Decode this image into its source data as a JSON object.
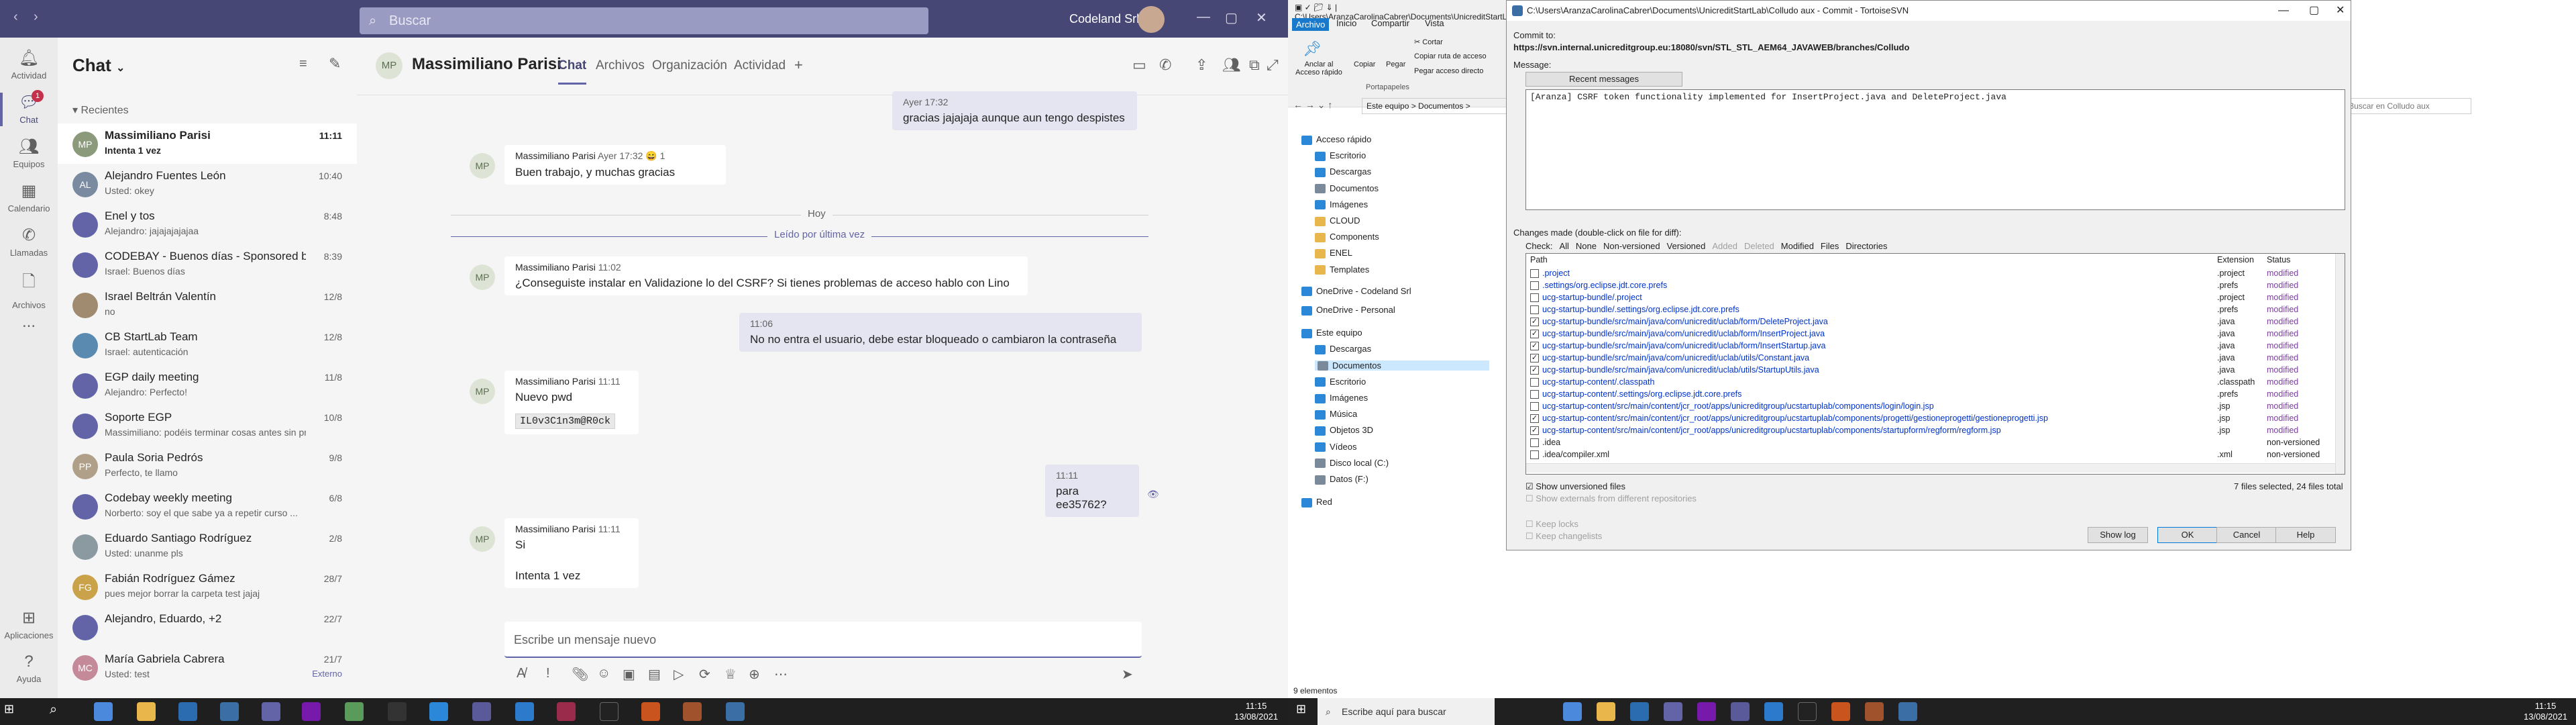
{
  "teams": {
    "search_placeholder": "Buscar",
    "org": "Codeland Srl",
    "rail": [
      {
        "label": "Actividad",
        "icon": "bell-icon"
      },
      {
        "label": "Chat",
        "icon": "chat-icon",
        "badge": "1"
      },
      {
        "label": "Equipos",
        "icon": "teams-icon"
      },
      {
        "label": "Calendario",
        "icon": "calendar-icon"
      },
      {
        "label": "Llamadas",
        "icon": "phone-icon"
      },
      {
        "label": "Archivos",
        "icon": "file-icon"
      },
      {
        "label": "...",
        "icon": "more-icon"
      },
      {
        "label": "Aplicaciones",
        "icon": "apps-icon"
      },
      {
        "label": "Ayuda",
        "icon": "help-icon"
      }
    ],
    "chatlist": {
      "title": "Chat",
      "section": "Recientes",
      "items": [
        {
          "initials": "MP",
          "name": "Massimiliano Parisi",
          "preview": "Intenta 1 vez",
          "time": "11:11",
          "color": "#8a9a7b"
        },
        {
          "initials": "AL",
          "name": "Alejandro Fuentes León",
          "preview": "Usted: okey",
          "time": "10:40",
          "color": "#7a8aa0"
        },
        {
          "initials": "",
          "name": "Enel y tos",
          "preview": "Alejandro: jajajajajajaa",
          "time": "8:48",
          "color": "#6264a7"
        },
        {
          "initials": "",
          "name": "CODEBAY - Buenos días - Sponsored by...",
          "preview": "Israel: Buenos días",
          "time": "8:39",
          "color": "#6264a7"
        },
        {
          "initials": "",
          "name": "Israel Beltrán Valentín",
          "preview": "no",
          "time": "12/8",
          "color": "#a08a70"
        },
        {
          "initials": "",
          "name": "CB StartLab Team",
          "preview": "Israel: autenticación",
          "time": "12/8",
          "color": "#5a8ab0"
        },
        {
          "initials": "",
          "name": "EGP daily meeting",
          "preview": "Alejandro: Perfecto!",
          "time": "11/8",
          "color": "#6264a7"
        },
        {
          "initials": "",
          "name": "Soporte EGP",
          "preview": "Massimiliano: podéis terminar cosas antes sin pr...",
          "time": "10/8",
          "color": "#6264a7"
        },
        {
          "initials": "PP",
          "name": "Paula Soria Pedrós",
          "preview": "Perfecto, te llamo",
          "time": "9/8",
          "color": "#b0a08a"
        },
        {
          "initials": "",
          "name": "Codebay weekly meeting",
          "preview": "Norberto: soy el que sabe ya a repetir curso ...",
          "time": "6/8",
          "color": "#6264a7"
        },
        {
          "initials": "",
          "name": "Eduardo Santiago Rodríguez",
          "preview": "Usted: unanme pls",
          "time": "2/8",
          "color": "#8a9aa0"
        },
        {
          "initials": "FG",
          "name": "Fabián Rodríguez Gámez",
          "preview": "pues mejor borrar la carpeta test jajaj",
          "time": "28/7",
          "color": "#c9a24a"
        },
        {
          "initials": "",
          "name": "Alejandro, Eduardo, +2",
          "preview": "",
          "time": "22/7",
          "color": "#6264a7"
        },
        {
          "initials": "MC",
          "name": "María Gabriela Cabrera",
          "preview": "Usted: test",
          "time": "21/7",
          "extra": "Externo",
          "color": "#c48a9a"
        }
      ]
    },
    "conversation": {
      "initials": "MP",
      "name": "Massimiliano Parisi",
      "tabs": [
        "Chat",
        "Archivos",
        "Organización",
        "Actividad"
      ],
      "messages": [
        {
          "mine": true,
          "meta": "Ayer 17:32",
          "text": "gracias jajajaja aunque aun tengo despistes"
        },
        {
          "mine": false,
          "author": "Massimiliano Parisi",
          "meta": "Ayer 17:32",
          "reaction": "😄 1",
          "text": "Buen trabajo, y muchas gracias"
        },
        {
          "mine": false,
          "author": "Massimiliano Parisi",
          "meta": "11:02",
          "text": "¿Conseguiste instalar en Validazione lo del CSRF? Si tienes problemas de acceso hablo con Lino"
        },
        {
          "mine": true,
          "meta": "11:06",
          "text": "No no entra el usuario, debe estar bloqueado o cambiaron la contraseña"
        },
        {
          "mine": false,
          "author": "Massimiliano Parisi",
          "meta": "11:11",
          "text": "Nuevo pwd",
          "code": "IL0v3C1n3m@R0ck"
        },
        {
          "mine": true,
          "meta": "11:11",
          "text": "para ee35762?"
        },
        {
          "mine": false,
          "author": "Massimiliano Parisi",
          "meta": "11:11",
          "text": "Si",
          "text2": "Intenta 1 vez"
        }
      ],
      "day_label": "Hoy",
      "read_label": "Leído por última vez",
      "compose_placeholder": "Escribe un mensaje nuevo"
    }
  },
  "taskbar_left": {
    "time": "11:15",
    "date": "13/08/2021"
  },
  "explorer": {
    "path_title": "C:\\Users\\AranzaCarolinaCabrer\\Documents\\UnicreditStartLab\\Colludo aux",
    "tabs": [
      "Archivo",
      "Inicio",
      "Compartir",
      "Vista"
    ],
    "ribbon": {
      "pin": "Anclar al Acceso rápido",
      "copy": "Copiar",
      "paste": "Pegar",
      "cut": "Cortar",
      "copy_path": "Copiar ruta de acceso",
      "paste_shortcut": "Pegar acceso directo",
      "group": "Portapapeles"
    },
    "address": "Este equipo  >  Documentos  >",
    "search_placeholder": "Buscar en Colludo aux",
    "nav": [
      {
        "label": "Acceso rápido",
        "color": "#2b88d8",
        "indent": 0
      },
      {
        "label": "Escritorio",
        "color": "#2b88d8",
        "indent": 1
      },
      {
        "label": "Descargas",
        "color": "#2b88d8",
        "indent": 1
      },
      {
        "label": "Documentos",
        "color": "#7a8a9a",
        "indent": 1
      },
      {
        "label": "Imágenes",
        "color": "#2b88d8",
        "indent": 1
      },
      {
        "label": "CLOUD",
        "color": "#e8b64a",
        "indent": 1
      },
      {
        "label": "Components",
        "color": "#e8b64a",
        "indent": 1
      },
      {
        "label": "ENEL",
        "color": "#e8b64a",
        "indent": 1
      },
      {
        "label": "Templates",
        "color": "#e8b64a",
        "indent": 1
      },
      {
        "label": "OneDrive - Codeland Srl",
        "color": "#2b88d8",
        "indent": 0
      },
      {
        "label": "OneDrive - Personal",
        "color": "#2b88d8",
        "indent": 0
      },
      {
        "label": "Este equipo",
        "color": "#2b88d8",
        "indent": 0
      },
      {
        "label": "Descargas",
        "color": "#2b88d8",
        "indent": 1
      },
      {
        "label": "Documentos",
        "color": "#7a8a9a",
        "indent": 1,
        "selected": true
      },
      {
        "label": "Escritorio",
        "color": "#2b88d8",
        "indent": 1
      },
      {
        "label": "Imágenes",
        "color": "#2b88d8",
        "indent": 1
      },
      {
        "label": "Música",
        "color": "#2b88d8",
        "indent": 1
      },
      {
        "label": "Objetos 3D",
        "color": "#2b88d8",
        "indent": 1
      },
      {
        "label": "Vídeos",
        "color": "#2b88d8",
        "indent": 1
      },
      {
        "label": "Disco local (C:)",
        "color": "#7a8a9a",
        "indent": 1
      },
      {
        "label": "Datos (F:)",
        "color": "#7a8a9a",
        "indent": 1
      },
      {
        "label": "Red",
        "color": "#2b88d8",
        "indent": 0
      }
    ],
    "status": "9 elementos"
  },
  "svn": {
    "title": "C:\\Users\\AranzaCarolinaCabrer\\Documents\\UnicreditStartLab\\Colludo aux - Commit - TortoiseSVN",
    "commit_to_label": "Commit to:",
    "url": "https://svn.internal.unicreditgroup.eu:18080/svn/STL_STL_AEM64_JAVAWEB/branches/Colludo",
    "message_label": "Message:",
    "recent_button": "Recent messages",
    "message": "[Aranza] CSRF token functionality implemented for InsertProject.java and DeleteProject.java",
    "changes_label": "Changes made (double-click on file for diff):",
    "check_label": "Check:",
    "check_options": [
      "All",
      "None",
      "Non-versioned",
      "Versioned",
      "Added",
      "Deleted",
      "Modified",
      "Files",
      "Directories"
    ],
    "columns": [
      "Path",
      "Extension",
      "Status"
    ],
    "files": [
      {
        "checked": false,
        "path": ".project",
        "ext": ".project",
        "status": "modified"
      },
      {
        "checked": false,
        "path": ".settings/org.eclipse.jdt.core.prefs",
        "ext": ".prefs",
        "status": "modified"
      },
      {
        "checked": false,
        "path": "ucg-startup-bundle/.project",
        "ext": ".project",
        "status": "modified"
      },
      {
        "checked": false,
        "path": "ucg-startup-bundle/.settings/org.eclipse.jdt.core.prefs",
        "ext": ".prefs",
        "status": "modified"
      },
      {
        "checked": true,
        "path": "ucg-startup-bundle/src/main/java/com/unicredit/uclab/form/DeleteProject.java",
        "ext": ".java",
        "status": "modified"
      },
      {
        "checked": true,
        "path": "ucg-startup-bundle/src/main/java/com/unicredit/uclab/form/InsertProject.java",
        "ext": ".java",
        "status": "modified"
      },
      {
        "checked": true,
        "path": "ucg-startup-bundle/src/main/java/com/unicredit/uclab/form/InsertStartup.java",
        "ext": ".java",
        "status": "modified"
      },
      {
        "checked": true,
        "path": "ucg-startup-bundle/src/main/java/com/unicredit/uclab/utils/Constant.java",
        "ext": ".java",
        "status": "modified"
      },
      {
        "checked": true,
        "path": "ucg-startup-bundle/src/main/java/com/unicredit/uclab/utils/StartupUtils.java",
        "ext": ".java",
        "status": "modified"
      },
      {
        "checked": false,
        "path": "ucg-startup-content/.classpath",
        "ext": ".classpath",
        "status": "modified"
      },
      {
        "checked": false,
        "path": "ucg-startup-content/.settings/org.eclipse.jdt.core.prefs",
        "ext": ".prefs",
        "status": "modified"
      },
      {
        "checked": false,
        "path": "ucg-startup-content/src/main/content/jcr_root/apps/unicreditgroup/ucstartuplab/components/login/login.jsp",
        "ext": ".jsp",
        "status": "modified"
      },
      {
        "checked": true,
        "path": "ucg-startup-content/src/main/content/jcr_root/apps/unicreditgroup/ucstartuplab/components/progetti/gestioneprogetti/gestioneprogetti.jsp",
        "ext": ".jsp",
        "status": "modified"
      },
      {
        "checked": true,
        "path": "ucg-startup-content/src/main/content/jcr_root/apps/unicreditgroup/ucstartuplab/components/startupform/regform/regform.jsp",
        "ext": ".jsp",
        "status": "modified"
      },
      {
        "checked": false,
        "path": ".idea",
        "ext": "",
        "status": "non-versioned"
      },
      {
        "checked": false,
        "path": ".idea/compiler.xml",
        "ext": ".xml",
        "status": "non-versioned"
      }
    ],
    "show_unversioned": "Show unversioned files",
    "show_externals": "Show externals from different repositories",
    "summary": "7 files selected, 24 files total",
    "keep_locks": "Keep locks",
    "keep_changelists": "Keep changelists",
    "buttons": {
      "show_log": "Show log",
      "ok": "OK",
      "cancel": "Cancel",
      "help": "Help"
    }
  },
  "taskbar_right": {
    "search": "Escribe aquí para buscar",
    "time": "11:15",
    "date": "13/08/2021"
  }
}
